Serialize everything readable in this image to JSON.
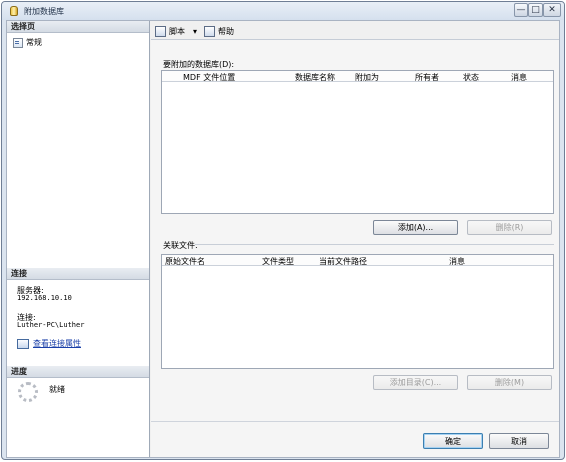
{
  "window": {
    "title": "附加数据库",
    "min_glyph": "—",
    "max_glyph": "□",
    "close_glyph": "✕"
  },
  "left": {
    "select_page_header": "选择页",
    "pages": [
      {
        "label": "常规"
      }
    ],
    "connection_header": "连接",
    "server_label": "服务器:",
    "server_value": "192.168.10.10",
    "connection_label": "连接:",
    "connection_value": "Luther-PC\\Luther",
    "view_connection_properties": "查看连接属性",
    "progress_header": "进度",
    "progress_status": "就绪"
  },
  "toolbar": {
    "script_label": "脚本",
    "dropdown_glyph": "▾",
    "help_label": "帮助"
  },
  "databases": {
    "label": "要附加的数据库(D):",
    "columns": [
      "MDF 文件位置",
      "数据库名称",
      "附加为",
      "所有者",
      "状态",
      "消息"
    ],
    "rows": [],
    "add_button": "添加(A)...",
    "remove_button": "删除(R)"
  },
  "files": {
    "label": "关联文件:",
    "columns": [
      "原始文件名",
      "文件类型",
      "当前文件路径",
      "消息"
    ],
    "rows": [],
    "add_catalog_button": "添加目录(C)...",
    "remove_button": "删除(M)"
  },
  "footer": {
    "ok_button": "确定",
    "cancel_button": "取消"
  }
}
